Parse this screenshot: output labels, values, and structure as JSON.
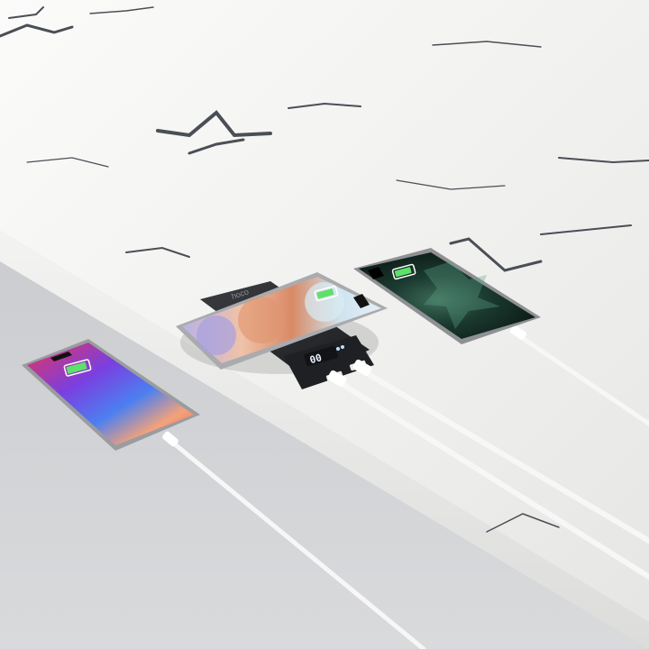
{
  "scene": {
    "powerbank": {
      "brand_text": "hoco",
      "display_reading": "00"
    },
    "phones": [
      {
        "role": "wired-left",
        "wallpaper": "red-blue-gradient",
        "charging_indicator": "battery-charging-icon"
      },
      {
        "role": "wireless-top",
        "wallpaper": "pastel-rings",
        "charging_indicator": "battery-charging-icon"
      },
      {
        "role": "wired-right",
        "wallpaper": "dark-green-splash",
        "charging_indicator": "battery-charging-icon"
      }
    ],
    "cables": [
      "lightning-cable-left",
      "usb-cable-1",
      "usb-cable-2",
      "lightning-cable-right"
    ],
    "colors": {
      "floor": "#cfd0d3",
      "marble": "#f2f2f0",
      "veins": "#4a4f55",
      "powerbank": "#26282b",
      "display": "#e8f2ff",
      "cable": "#f7f7f7"
    }
  }
}
